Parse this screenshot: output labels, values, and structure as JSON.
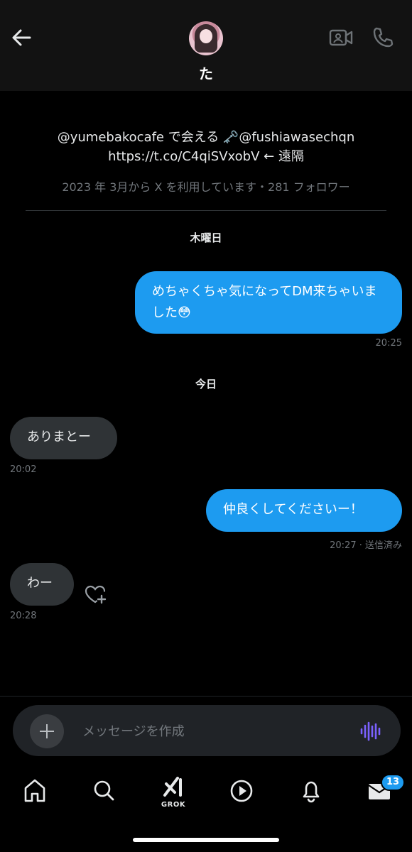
{
  "header": {
    "contact_name": "た"
  },
  "profile": {
    "bio_line1": "@yumebakocafe で会える 🗝️@fushiawasechqn",
    "bio_line2": "https://t.co/C4qiSVxobV ← 遠隔",
    "meta": "2023 年 3月から X を利用しています・281 フォロワー"
  },
  "conversation": {
    "day1": "木曜日",
    "msg1": {
      "text": "めちゃくちゃ気になってDM来ちゃいました😳",
      "time": "20:25"
    },
    "day2": "今日",
    "msg2": {
      "text": "ありまとー",
      "time": "20:02"
    },
    "msg3": {
      "text": "仲良くしてくださいー！",
      "time": "20:27 · 送信済み"
    },
    "msg4": {
      "text": "わー",
      "time": "20:28"
    }
  },
  "composer": {
    "placeholder": "メッセージを作成"
  },
  "nav": {
    "grok_label": "GROK",
    "messages_badge": "13",
    "accent": "#1d9bf0"
  }
}
